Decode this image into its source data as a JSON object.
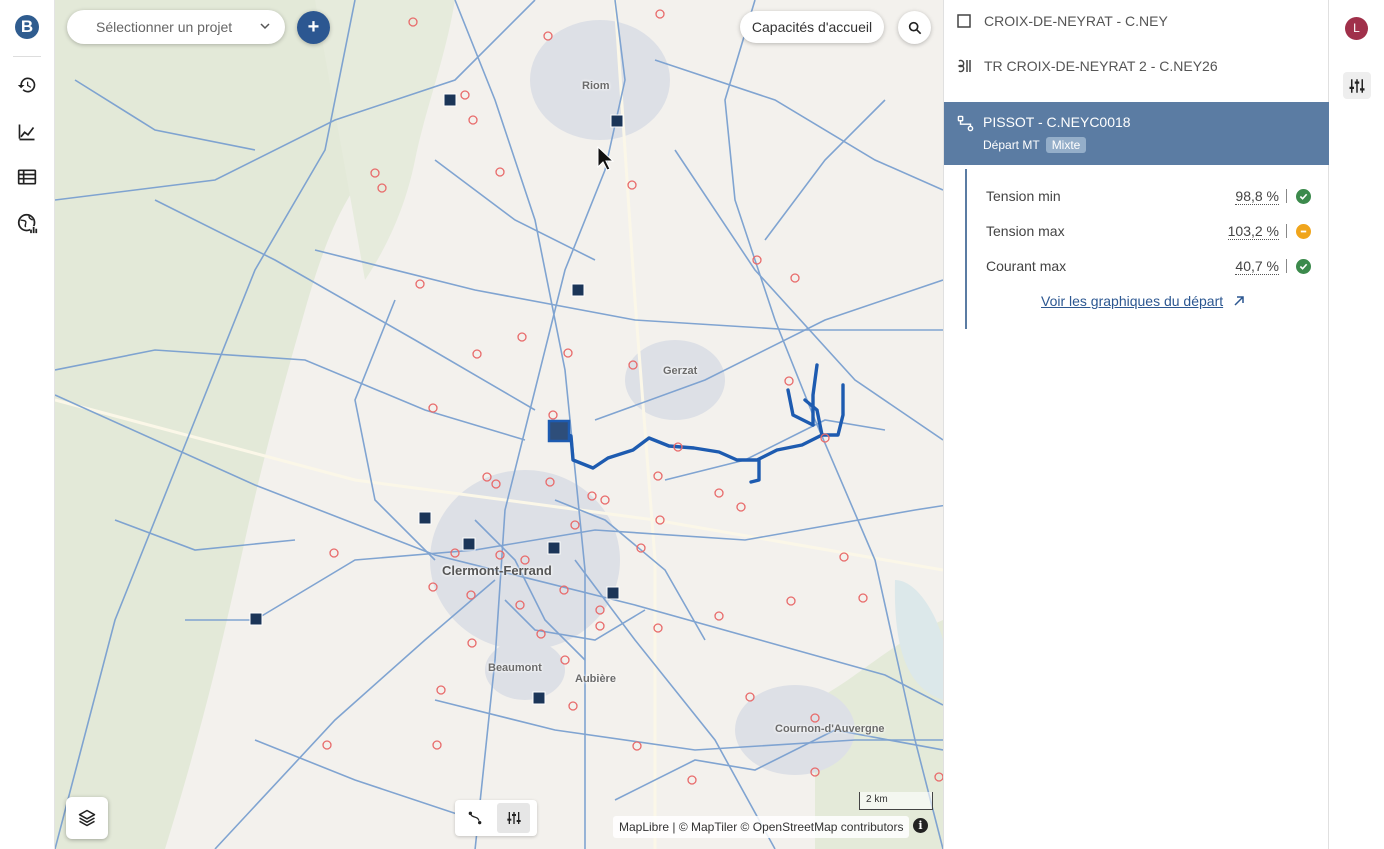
{
  "nav": {
    "logo": "B",
    "items": [
      "history-icon",
      "chart-line-icon",
      "table-icon",
      "globe-chart-icon"
    ]
  },
  "map": {
    "project_select": "Sélectionner un projet",
    "add_label": "+",
    "capacity_label": "Capacités d'accueil",
    "places": {
      "riom": "Riom",
      "gerzat": "Gerzat",
      "clermont": "Clermont-Ferrand",
      "beaumont": "Beaumont",
      "aubiere": "Aubière",
      "cournon": "Cournon-d'Auvergne"
    },
    "scale": "2 km",
    "attribution": "MapLibre | © MapTiler © OpenStreetMap contributors",
    "info": "i",
    "colors": {
      "network": "#7aa0d0",
      "selected_line": "#1d5bb0",
      "substation": "#1b3558",
      "marker": "#e86a6a"
    }
  },
  "panel": {
    "items": [
      {
        "icon": "checkbox-icon",
        "label": "CROIX-DE-NEYRAT - C.NEY"
      },
      {
        "icon": "transformer-icon",
        "label": "TR CROIX-DE-NEYRAT 2 - C.NEY26"
      }
    ],
    "selected": {
      "title": "PISSOT - C.NEYC0018",
      "subtitle": "Départ MT",
      "tag": "Mixte"
    },
    "metrics": [
      {
        "label": "Tension min",
        "value": "98,8 %",
        "status": "ok"
      },
      {
        "label": "Tension max",
        "value": "103,2 %",
        "status": "warn"
      },
      {
        "label": "Courant max",
        "value": "40,7 %",
        "status": "ok"
      }
    ],
    "link": "Voir les graphiques du départ"
  },
  "user": {
    "initial": "L"
  }
}
